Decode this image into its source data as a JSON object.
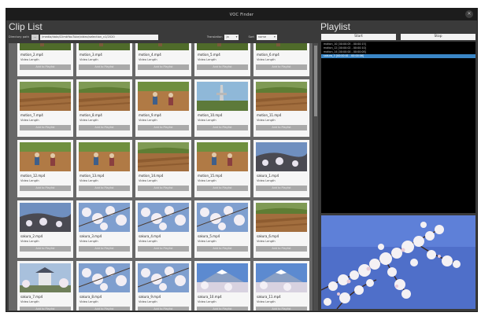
{
  "window": {
    "title": "VOC Finder"
  },
  "clip_list": {
    "heading": "Clip List",
    "directory_label": "Directory path",
    "browse_label": "...",
    "directory_path": "/media/data/ClimbYouTube/video/selection_v1/2020",
    "sort_label": "Translation",
    "sort_value": "ja",
    "filter_label": "Sort",
    "filter_value": "name",
    "clips": [
      {
        "name": "motion_2.mp4",
        "length": "Video Length",
        "button": "Add to Playlist",
        "thumb": "green"
      },
      {
        "name": "motion_3.mp4",
        "length": "Video Length",
        "button": "Add to Playlist",
        "thumb": "green"
      },
      {
        "name": "motion_4.mp4",
        "length": "Video Length",
        "button": "Add to Playlist",
        "thumb": "green"
      },
      {
        "name": "motion_5.mp4",
        "length": "Video Length",
        "button": "Add to Playlist",
        "thumb": "green"
      },
      {
        "name": "motion_6.mp4",
        "length": "Video Length",
        "button": "Add to Playlist",
        "thumb": "green"
      },
      {
        "name": "motion_7.mp4",
        "length": "Video Length",
        "button": "Add to Playlist",
        "thumb": "field"
      },
      {
        "name": "motion_8.mp4",
        "length": "Video Length",
        "button": "Add to Playlist",
        "thumb": "field"
      },
      {
        "name": "motion_9.mp4",
        "length": "Video Length",
        "button": "Add to Playlist",
        "thumb": "people"
      },
      {
        "name": "motion_10.mp4",
        "length": "Video Length",
        "button": "Add to Playlist",
        "thumb": "skytree"
      },
      {
        "name": "motion_11.mp4",
        "length": "Video Length",
        "button": "Add to Playlist",
        "thumb": "field"
      },
      {
        "name": "motion_12.mp4",
        "length": "Video Length",
        "button": "Add to Playlist",
        "thumb": "people"
      },
      {
        "name": "motion_13.mp4",
        "length": "Video Length",
        "button": "Add to Playlist",
        "thumb": "people"
      },
      {
        "name": "motion_14.mp4",
        "length": "Video Length",
        "button": "Add to Playlist",
        "thumb": "field"
      },
      {
        "name": "motion_15.mp4",
        "length": "Video Length",
        "button": "Add to Playlist",
        "thumb": "people"
      },
      {
        "name": "sakura_1.mp4",
        "length": "Video Length",
        "button": "Add to Playlist",
        "thumb": "hill"
      },
      {
        "name": "sakura_2.mp4",
        "length": "Video Length",
        "button": "Add to Playlist",
        "thumb": "hill"
      },
      {
        "name": "sakura_3.mp4",
        "length": "Video Length",
        "button": "Add to Playlist",
        "thumb": "blossom"
      },
      {
        "name": "sakura_4.mp4",
        "length": "Video Length",
        "button": "Add to Playlist",
        "thumb": "blossom"
      },
      {
        "name": "sakura_5.mp4",
        "length": "Video Length",
        "button": "Add to Playlist",
        "thumb": "blossom"
      },
      {
        "name": "sakura_6.mp4",
        "length": "Video Length",
        "button": "Add to Playlist",
        "thumb": "field"
      },
      {
        "name": "sakura_7.mp4",
        "length": "Video Length",
        "button": "Add to Playlist",
        "thumb": "castle"
      },
      {
        "name": "sakura_8.mp4",
        "length": "Video Length",
        "button": "Add to Playlist",
        "thumb": "blossom"
      },
      {
        "name": "sakura_9.mp4",
        "length": "Video Length",
        "button": "Add to Playlist",
        "thumb": "blossom"
      },
      {
        "name": "sakura_10.mp4",
        "length": "Video Length",
        "button": "Add to Playlist",
        "thumb": "fuji"
      },
      {
        "name": "sakura_11.mp4",
        "length": "Video Length",
        "button": "Add to Playlist",
        "thumb": "fuji"
      }
    ]
  },
  "playlist": {
    "heading": "Playlist",
    "start_label": "Start",
    "stop_label": "Stop",
    "items": [
      {
        "text": "motion_10 [00:00:05 - 00:00:15]",
        "selected": false
      },
      {
        "text": "motion_12 [00:00:02 - 00:00:10]",
        "selected": false
      },
      {
        "text": "motion_14 [00:00:00 - 00:00:08]",
        "selected": false
      },
      {
        "text": "sakura_3 [00:00:01 - 00:00:06]",
        "selected": true
      }
    ]
  },
  "colors": {
    "window_bg": "#3a3a3a",
    "titlebar_bg": "#1c1c1c",
    "grid_bg": "#686868",
    "selected_row": "#3a86c6",
    "add_button": "#a9a9a9"
  }
}
